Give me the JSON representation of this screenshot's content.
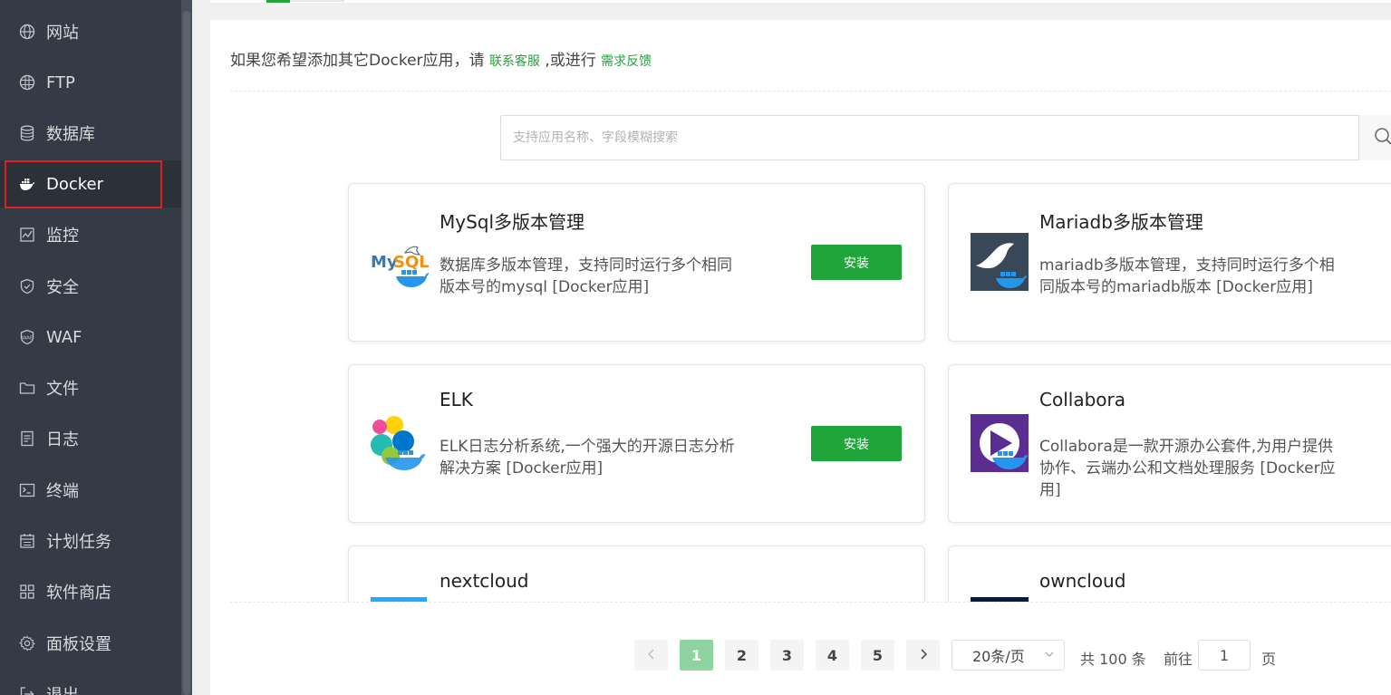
{
  "sidebar": {
    "items": [
      {
        "label": "网站",
        "icon": "globe-icon"
      },
      {
        "label": "FTP",
        "icon": "ftp-icon"
      },
      {
        "label": "数据库",
        "icon": "database-icon"
      },
      {
        "label": "Docker",
        "icon": "docker-icon",
        "active": true
      },
      {
        "label": "监控",
        "icon": "monitor-icon"
      },
      {
        "label": "安全",
        "icon": "shield-icon"
      },
      {
        "label": "WAF",
        "icon": "waf-shield-icon"
      },
      {
        "label": "文件",
        "icon": "folder-icon"
      },
      {
        "label": "日志",
        "icon": "log-icon"
      },
      {
        "label": "终端",
        "icon": "terminal-icon"
      },
      {
        "label": "计划任务",
        "icon": "calendar-icon"
      },
      {
        "label": "软件商店",
        "icon": "grid-icon"
      },
      {
        "label": "面板设置",
        "icon": "gear-icon"
      },
      {
        "label": "退出",
        "icon": "logout-icon"
      }
    ]
  },
  "notice": {
    "prefix": "如果您希望添加其它Docker应用，请",
    "contact_link": "联系客服",
    "middle": ",或进行",
    "feedback_link": "需求反馈"
  },
  "search": {
    "placeholder": "支持应用名称、字段模糊搜索",
    "value": "",
    "icon": "search-icon"
  },
  "apps": [
    {
      "name": "MySql多版本管理",
      "desc": "数据库多版本管理，支持同时运行多个相同版本号的mysql [Docker应用]",
      "action": "安装",
      "logo": "mysql-docker-logo"
    },
    {
      "name": "Mariadb多版本管理",
      "desc": "mariadb多版本管理，支持同时运行多个相同版本号的mariadb版本 [Docker应用]",
      "logo": "mariadb-docker-logo"
    },
    {
      "name": "ELK",
      "desc": "ELK日志分析系统,一个强大的开源日志分析解决方案 [Docker应用]",
      "action": "安装",
      "logo": "elk-docker-logo"
    },
    {
      "name": "Collabora",
      "desc": "Collabora是一款开源办公套件,为用户提供协作、云端办公和文档处理服务 [Docker应用]",
      "logo": "collabora-docker-logo"
    },
    {
      "name": "nextcloud",
      "desc": "",
      "logo": "nextcloud-logo"
    },
    {
      "name": "owncloud",
      "desc": "",
      "logo": "owncloud-logo"
    }
  ],
  "pagination": {
    "pages": [
      "1",
      "2",
      "3",
      "4",
      "5"
    ],
    "current": "1",
    "page_size": "20条/页",
    "total": "共 100 条",
    "goto_label": "前往",
    "goto_value": "1",
    "page_suffix": "页"
  },
  "colors": {
    "sidebar_bg": "#353b46",
    "accent_green": "#20a53a",
    "active_outline": "#e02020"
  }
}
